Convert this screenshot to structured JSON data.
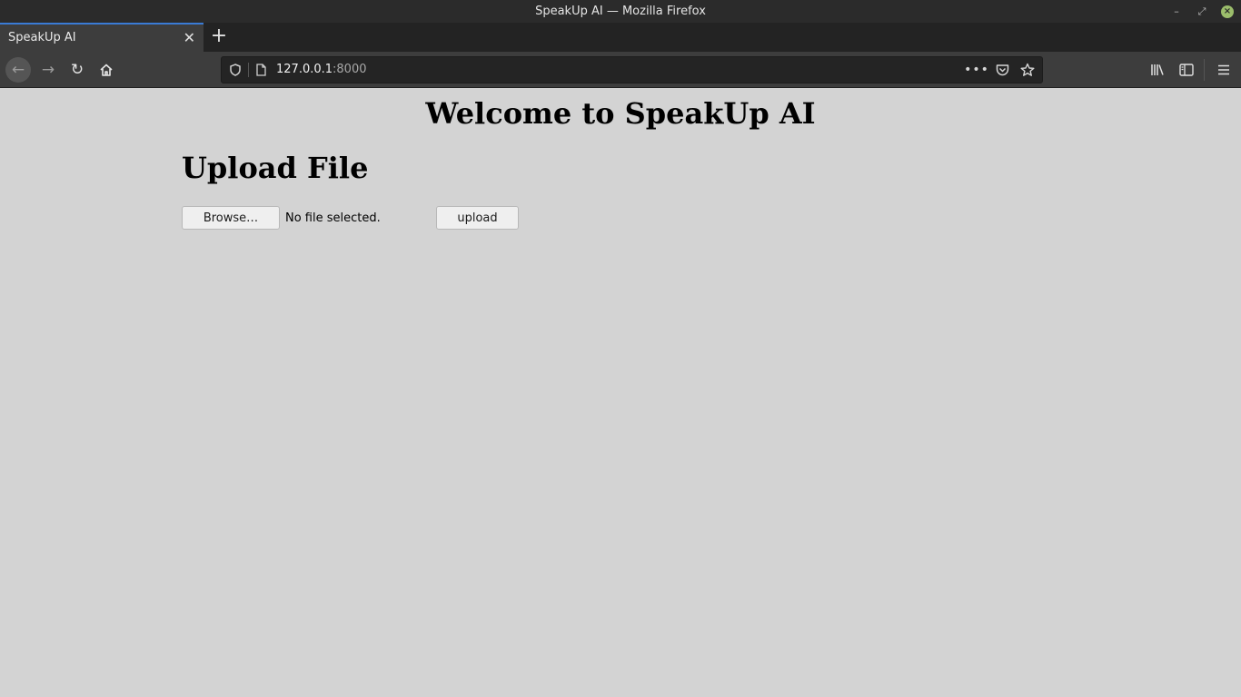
{
  "window": {
    "title": "SpeakUp AI — Mozilla Firefox",
    "minimize_glyph": "–",
    "restore_glyph": "⤢",
    "close_glyph": "×"
  },
  "tabs": [
    {
      "label": "SpeakUp AI",
      "close_glyph": "✕"
    }
  ],
  "new_tab_glyph": "+",
  "navigation": {
    "back_glyph": "←",
    "forward_glyph": "→",
    "reload_glyph": "↻",
    "home_glyph": "⌂"
  },
  "urlbar": {
    "host": "127.0.0.1",
    "port": ":8000",
    "more_glyph": "•••",
    "pocket_glyph": "♡",
    "star_glyph": "☆"
  },
  "toolbar": {
    "library_glyph": "⫼",
    "sidebar_glyph": "◫",
    "menu_glyph": "≡"
  },
  "page": {
    "heading": "Welcome to SpeakUp AI",
    "section_heading": "Upload File",
    "browse_label": "Browse…",
    "file_status": "No file selected.",
    "upload_label": "upload"
  }
}
